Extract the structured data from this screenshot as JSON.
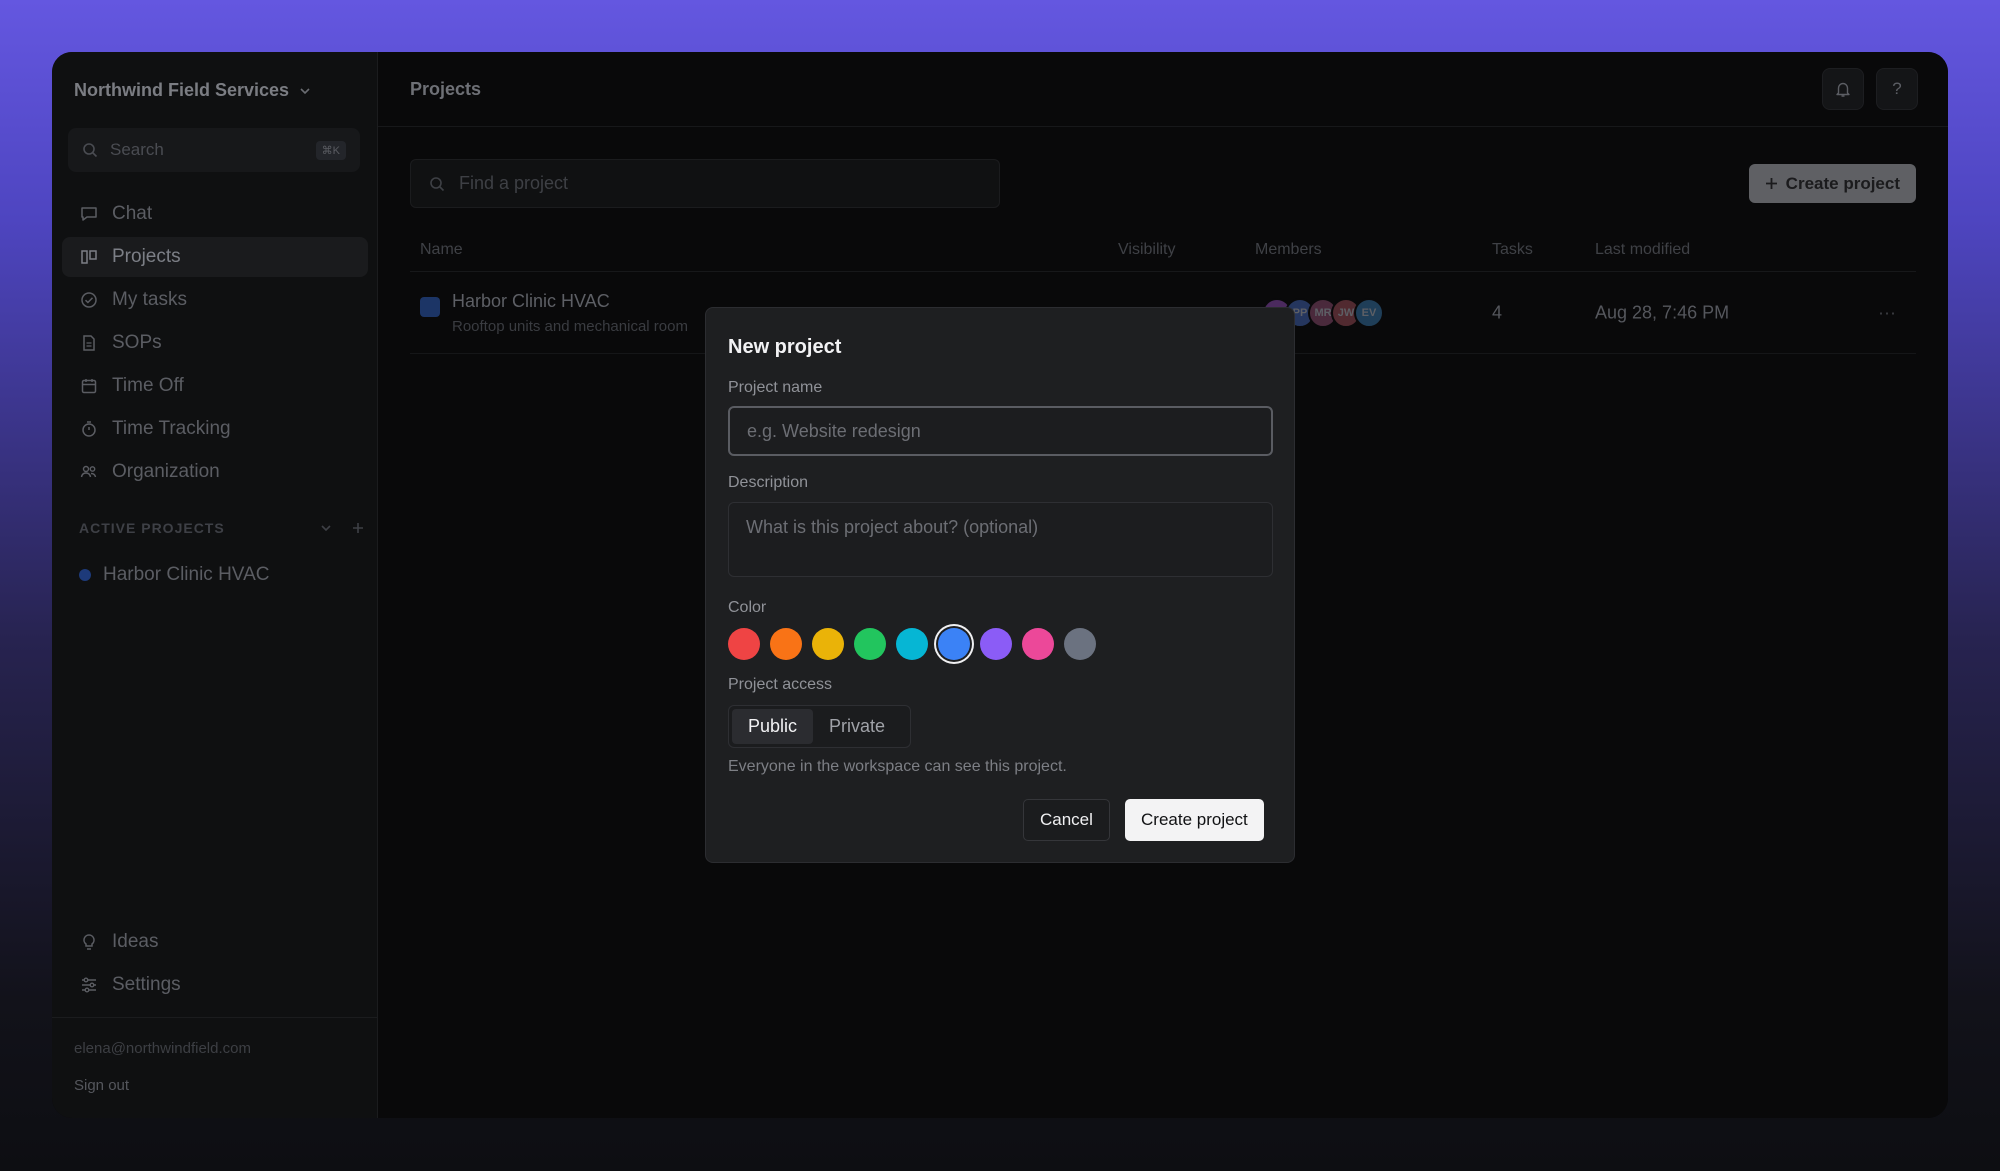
{
  "sidebar": {
    "workspace": "Northwind Field Services",
    "search": {
      "placeholder": "Search",
      "shortcut": "⌘K"
    },
    "nav": [
      {
        "label": "Chat",
        "icon": "chat-icon"
      },
      {
        "label": "Projects",
        "icon": "board-icon",
        "active": true
      },
      {
        "label": "My tasks",
        "icon": "check-circle-icon"
      },
      {
        "label": "SOPs",
        "icon": "document-icon"
      },
      {
        "label": "Time Off",
        "icon": "calendar-icon"
      },
      {
        "label": "Time Tracking",
        "icon": "timer-icon"
      },
      {
        "label": "Organization",
        "icon": "people-icon"
      }
    ],
    "section_title": "ACTIVE PROJECTS",
    "active_project": "Harbor Clinic HVAC",
    "bottom_nav": [
      {
        "label": "Ideas",
        "icon": "lightbulb-icon"
      },
      {
        "label": "Settings",
        "icon": "sliders-icon"
      }
    ],
    "email": "elena@northwindfield.com",
    "sign_out": "Sign out"
  },
  "header": {
    "title": "Projects",
    "help": "?"
  },
  "main": {
    "find_placeholder": "Find a project",
    "create_button": "Create project",
    "columns": [
      "Name",
      "Visibility",
      "Members",
      "Tasks",
      "Last modified"
    ],
    "rows": [
      {
        "name": "Harbor Clinic HVAC",
        "description": "Rooftop units and mechanical room",
        "members": [
          {
            "initials": "",
            "color": "#4b2a5e"
          },
          {
            "initials": "PP",
            "color": "#25365e"
          },
          {
            "initials": "MR",
            "color": "#4a2a3c"
          },
          {
            "initials": "JW",
            "color": "#512a30"
          },
          {
            "initials": "EV",
            "color": "#1f3e58"
          }
        ],
        "tasks": "4",
        "modified": "Aug 28, 7:46 PM",
        "more": "···"
      }
    ]
  },
  "modal": {
    "title": "New project",
    "name_label": "Project name",
    "name_placeholder": "e.g. Website redesign",
    "desc_label": "Description",
    "desc_placeholder": "What is this project about? (optional)",
    "color_label": "Color",
    "colors": [
      "#ef4444",
      "#f97316",
      "#eab308",
      "#22c55e",
      "#06b6d4",
      "#3b82f6",
      "#8b5cf6",
      "#ec4899",
      "#6b7280"
    ],
    "selected_color_index": 5,
    "access_label": "Project access",
    "access_options": [
      "Public",
      "Private"
    ],
    "access_selected": "Public",
    "access_hint": "Everyone in the workspace can see this project.",
    "cancel": "Cancel",
    "create": "Create project"
  }
}
